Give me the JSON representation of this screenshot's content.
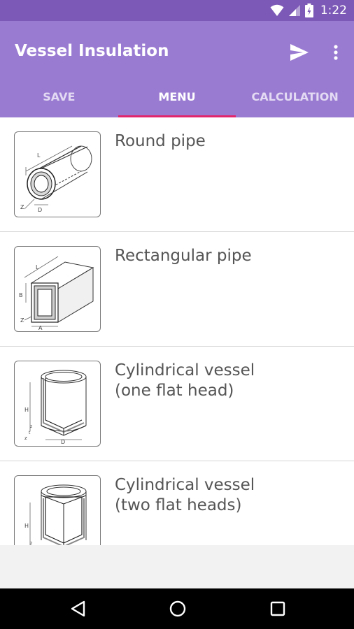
{
  "status_bar": {
    "time": "1:22",
    "icons": [
      "wifi-icon",
      "signal-icon",
      "battery-icon"
    ]
  },
  "app_bar": {
    "title": "Vessel Insulation",
    "actions": [
      "send-icon",
      "more-vert-icon"
    ],
    "color": "#9a7bd2"
  },
  "tabs": [
    {
      "label": "SAVE",
      "active": false
    },
    {
      "label": "MENU",
      "active": true
    },
    {
      "label": "CALCULATION",
      "active": false
    }
  ],
  "indicator_color": "#e3256c",
  "menu": [
    {
      "label": "Round pipe",
      "image": "round-pipe-diagram",
      "dims": [
        "L",
        "Z",
        "D"
      ]
    },
    {
      "label": "Rectangular pipe",
      "image": "rectangular-pipe-diagram",
      "dims": [
        "L",
        "B",
        "Z",
        "A"
      ]
    },
    {
      "label": "Cylindrical vessel\n(one flat head)",
      "image": "cylindrical-vessel-one-head-diagram",
      "dims": [
        "H",
        "z",
        "D"
      ]
    },
    {
      "label": "Cylindrical vessel\n(two flat heads)",
      "image": "cylindrical-vessel-two-heads-diagram",
      "dims": [
        "H"
      ]
    }
  ],
  "nav_bar": [
    "back-icon",
    "home-icon",
    "recents-icon"
  ]
}
